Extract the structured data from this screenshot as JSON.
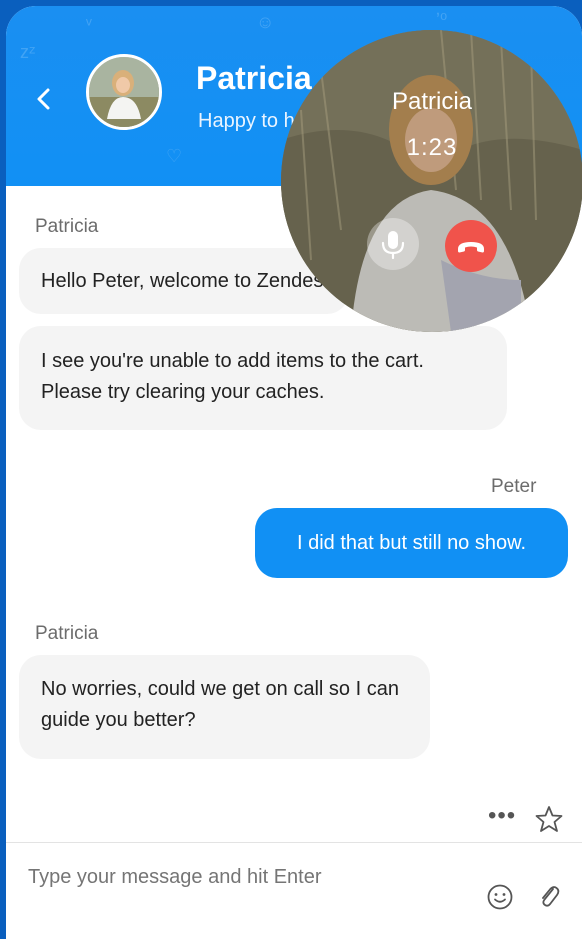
{
  "header": {
    "agent_name": "Patricia",
    "agent_status": "Happy to help"
  },
  "messages": [
    {
      "sender": "Patricia",
      "text": "Hello Peter, welcome to Zendesk"
    },
    {
      "sender": "Patricia",
      "text": "I see you're unable to add items to the cart. Please try clearing your caches."
    },
    {
      "sender": "Peter",
      "text": "I did that but still no show."
    },
    {
      "sender": "Patricia",
      "text": "No worries, could we get on call so I can guide you better?"
    }
  ],
  "composer": {
    "placeholder": "Type your message and hit Enter"
  },
  "call": {
    "name": "Patricia",
    "timer": "1:23"
  },
  "icons": {
    "back": "chevron-left-icon",
    "more": "more-dots-icon",
    "favorite": "star-icon",
    "emoji": "smiley-icon",
    "attach": "paperclip-icon",
    "mic": "microphone-icon",
    "hangup": "hang-up-icon"
  },
  "colors": {
    "brand": "#1190f4",
    "hangup": "#f0534b",
    "frame": "#0a5fbe"
  }
}
